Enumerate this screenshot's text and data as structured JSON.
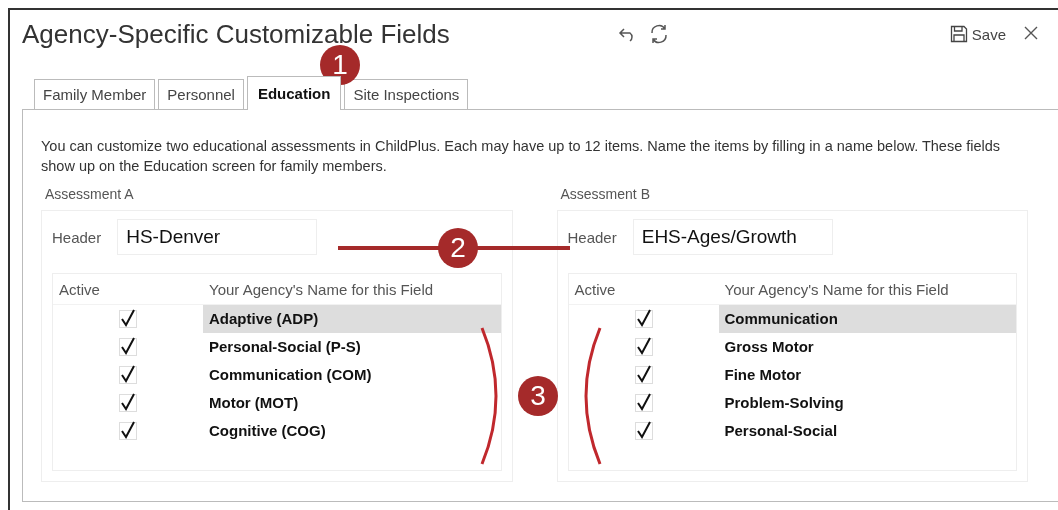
{
  "window": {
    "title": "Agency-Specific Customizable Fields",
    "save_label": "Save"
  },
  "tabs": [
    {
      "label": "Family Member",
      "selected": false
    },
    {
      "label": "Personnel",
      "selected": false
    },
    {
      "label": "Education",
      "selected": true
    },
    {
      "label": "Site Inspections",
      "selected": false
    }
  ],
  "description": "You can customize two educational assessments in ChildPlus.  Each may have up to 12 items.  Name the items by filling in a name below.  These fields show up on the Education screen for family members.",
  "assessments": [
    {
      "title": "Assessment A",
      "header_label": "Header",
      "header_value": "HS-Denver",
      "columns": [
        "Active",
        "Your Agency's Name for this Field"
      ],
      "rows": [
        {
          "active": true,
          "name": "Adaptive (ADP)",
          "selected": true
        },
        {
          "active": true,
          "name": "Personal-Social (P-S)",
          "selected": false
        },
        {
          "active": true,
          "name": "Communication (COM)",
          "selected": false
        },
        {
          "active": true,
          "name": "Motor (MOT)",
          "selected": false
        },
        {
          "active": true,
          "name": "Cognitive (COG)",
          "selected": false
        }
      ]
    },
    {
      "title": "Assessment B",
      "header_label": "Header",
      "header_value": "EHS-Ages/Growth",
      "columns": [
        "Active",
        "Your Agency's Name for this Field"
      ],
      "rows": [
        {
          "active": true,
          "name": "Communication",
          "selected": true
        },
        {
          "active": true,
          "name": "Gross Motor",
          "selected": false
        },
        {
          "active": true,
          "name": "Fine Motor",
          "selected": false
        },
        {
          "active": true,
          "name": "Problem-Solving",
          "selected": false
        },
        {
          "active": true,
          "name": "Personal-Social",
          "selected": false
        }
      ]
    }
  ],
  "callouts": [
    {
      "label": "1"
    },
    {
      "label": "2"
    },
    {
      "label": "3"
    }
  ]
}
